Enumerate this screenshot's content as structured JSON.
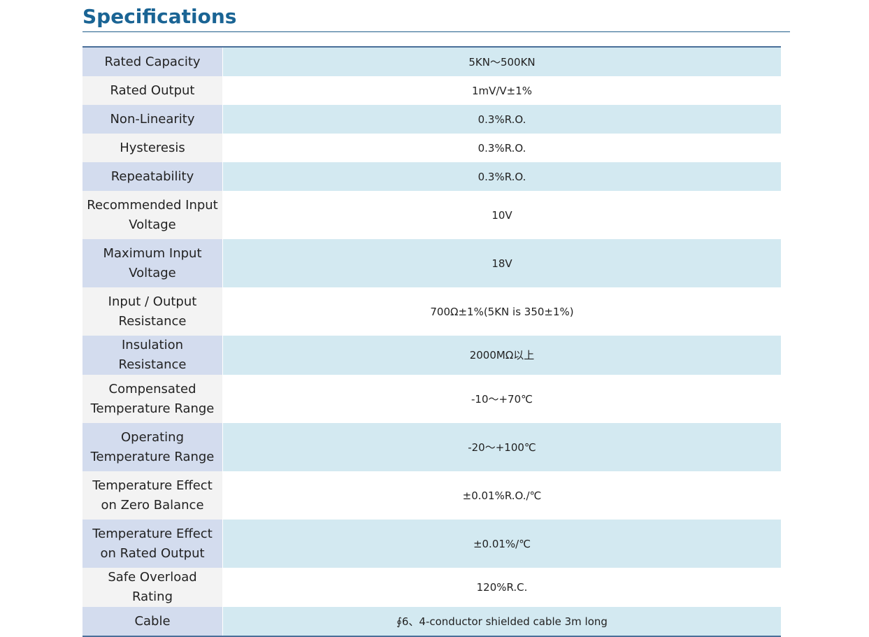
{
  "title": "Specifications",
  "rows": [
    {
      "label": "Rated Capacity",
      "value": "5KN～500KN"
    },
    {
      "label": "Rated Output",
      "value": "1mV/V±1%"
    },
    {
      "label": "Non-Linearity",
      "value": "0.3%R.O."
    },
    {
      "label": "Hysteresis",
      "value": "0.3%R.O."
    },
    {
      "label": "Repeatability",
      "value": "0.3%R.O."
    },
    {
      "label": "Recommended Input Voltage",
      "value": "10V"
    },
    {
      "label": "Maximum Input Voltage",
      "value": "18V"
    },
    {
      "label": "Input / Output Resistance",
      "value": "700Ω±1%(5KN is 350±1%)"
    },
    {
      "label": "Insulation Resistance",
      "value": "2000MΩ以上"
    },
    {
      "label": "Compensated Temperature Range",
      "value": "-10～+70℃"
    },
    {
      "label": "Operating Temperature Range",
      "value": "-20～+100℃"
    },
    {
      "label": "Temperature Effect on Zero Balance",
      "value": "±0.01%R.O./℃"
    },
    {
      "label": "Temperature Effect on Rated Output",
      "value": "±0.01%/℃"
    },
    {
      "label": "Safe Overload Rating",
      "value": "120%R.C."
    },
    {
      "label": "Cable",
      "value": "∮6、4-conductor shielded cable 3m long"
    }
  ]
}
